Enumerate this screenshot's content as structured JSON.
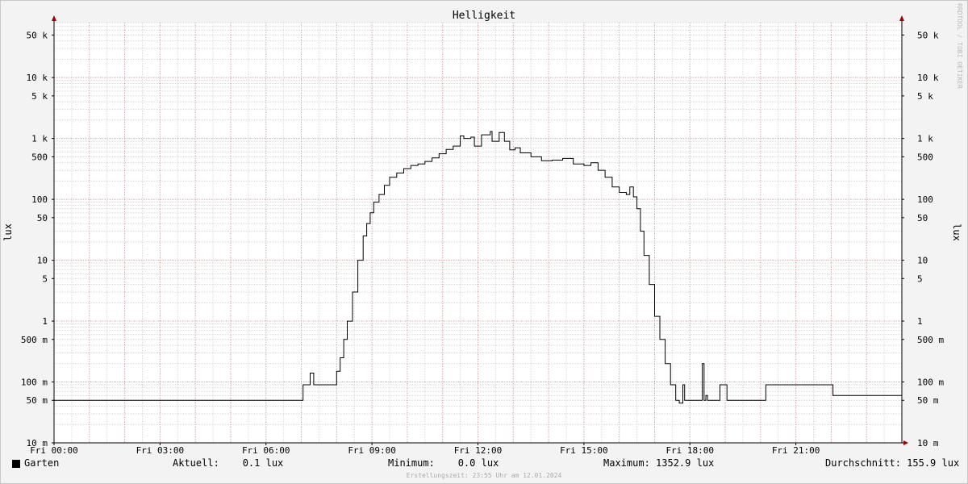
{
  "chart_data": {
    "type": "line",
    "title": "Helligkeit",
    "ylabel": "lux",
    "yscale": "log",
    "ylim": [
      0.01,
      80000
    ],
    "xlim": [
      0,
      24
    ],
    "y_ticks": [
      {
        "v": 50000,
        "label": "50 k"
      },
      {
        "v": 10000,
        "label": "10 k"
      },
      {
        "v": 5000,
        "label": "5 k"
      },
      {
        "v": 1000,
        "label": "1 k"
      },
      {
        "v": 500,
        "label": "500"
      },
      {
        "v": 100,
        "label": "100"
      },
      {
        "v": 50,
        "label": "50"
      },
      {
        "v": 10,
        "label": "10"
      },
      {
        "v": 5,
        "label": "5"
      },
      {
        "v": 1,
        "label": "1"
      },
      {
        "v": 0.5,
        "label": "500 m"
      },
      {
        "v": 0.1,
        "label": "100 m"
      },
      {
        "v": 0.05,
        "label": "50 m"
      },
      {
        "v": 0.01,
        "label": "10 m"
      }
    ],
    "x_ticks": [
      {
        "v": 0,
        "label": "Fri 00:00"
      },
      {
        "v": 3,
        "label": "Fri 03:00"
      },
      {
        "v": 6,
        "label": "Fri 06:00"
      },
      {
        "v": 9,
        "label": "Fri 09:00"
      },
      {
        "v": 12,
        "label": "Fri 12:00"
      },
      {
        "v": 15,
        "label": "Fri 15:00"
      },
      {
        "v": 18,
        "label": "Fri 18:00"
      },
      {
        "v": 21,
        "label": "Fri 21:00"
      }
    ],
    "grid": true,
    "series": [
      {
        "name": "Garten",
        "color": "#000000",
        "x": [
          0,
          6.95,
          7.05,
          7.25,
          7.35,
          7.45,
          7.9,
          8.0,
          8.1,
          8.2,
          8.3,
          8.45,
          8.6,
          8.75,
          8.85,
          8.95,
          9.05,
          9.2,
          9.35,
          9.5,
          9.7,
          9.9,
          10.1,
          10.3,
          10.5,
          10.7,
          10.9,
          11.1,
          11.3,
          11.5,
          11.6,
          11.8,
          11.9,
          12.1,
          12.35,
          12.4,
          12.6,
          12.75,
          12.9,
          13.05,
          13.2,
          13.5,
          13.8,
          14.1,
          14.4,
          14.7,
          15.0,
          15.2,
          15.4,
          15.6,
          15.8,
          16.0,
          16.2,
          16.3,
          16.4,
          16.5,
          16.6,
          16.7,
          16.85,
          17.0,
          17.15,
          17.3,
          17.45,
          17.6,
          17.7,
          17.8,
          17.85,
          17.9,
          18.0,
          18.3,
          18.35,
          18.4,
          18.45,
          18.5,
          18.6,
          18.8,
          18.85,
          19.0,
          19.05,
          20.1,
          20.15,
          22.0,
          22.05,
          24.0
        ],
        "y": [
          0.05,
          0.05,
          0.09,
          0.14,
          0.09,
          0.09,
          0.09,
          0.15,
          0.25,
          0.5,
          1.0,
          3.0,
          10.0,
          25.0,
          40.0,
          60.0,
          90.0,
          120.0,
          170.0,
          230.0,
          270.0,
          320.0,
          360.0,
          380.0,
          420.0,
          480.0,
          560.0,
          660.0,
          750.0,
          1100.0,
          1000.0,
          1050.0,
          750.0,
          1150.0,
          1300.0,
          900.0,
          1250.0,
          900.0,
          650.0,
          700.0,
          580.0,
          500.0,
          430.0,
          440.0,
          470.0,
          380.0,
          360.0,
          400.0,
          300.0,
          230.0,
          160.0,
          130.0,
          120.0,
          160.0,
          110.0,
          70.0,
          30.0,
          12.0,
          4.0,
          1.2,
          0.5,
          0.2,
          0.09,
          0.05,
          0.045,
          0.09,
          0.05,
          0.05,
          0.05,
          0.05,
          0.2,
          0.05,
          0.06,
          0.05,
          0.05,
          0.05,
          0.09,
          0.09,
          0.05,
          0.05,
          0.09,
          0.09,
          0.06,
          0.05
        ]
      }
    ]
  },
  "legend": {
    "series_label": "Garten",
    "current": "Aktuell:    0.1 lux",
    "minimum": "Minimum:    0.0 lux",
    "maximum": "Maximum: 1352.9 lux",
    "average": "Durchschnitt: 155.9 lux"
  },
  "footer": "Erstellungszeit: 23:55 Uhr am 12.01.2024",
  "credit": "RRDTOOL / TOBI OETIKER",
  "colors": {
    "background": "#f3f3f3",
    "plot": "#ffffff",
    "major_grid": "#e4a3a3",
    "minor_grid": "#d8d8d8",
    "axis_arrow": "#a00000"
  }
}
